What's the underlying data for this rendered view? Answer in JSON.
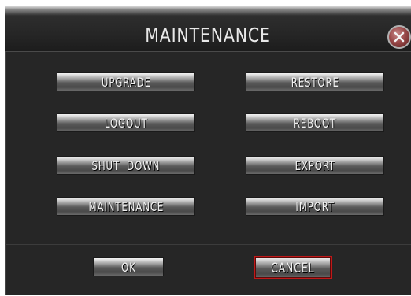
{
  "dialog": {
    "title": "MAINTENANCE",
    "close_icon": "close-x-icon"
  },
  "buttons": {
    "upgrade": "UPGRADE",
    "restore": "RESTORE",
    "logout": "LOGOUT",
    "reboot": "REBOOT",
    "shutdown": "SHUT  DOWN",
    "export": "EXPORT",
    "maintenance": "MAINTENANCE",
    "import": "IMPORT"
  },
  "footer": {
    "ok": "OK",
    "cancel": "CANCEL"
  },
  "colors": {
    "focus_border": "#c01818",
    "panel_background": "#262626"
  }
}
